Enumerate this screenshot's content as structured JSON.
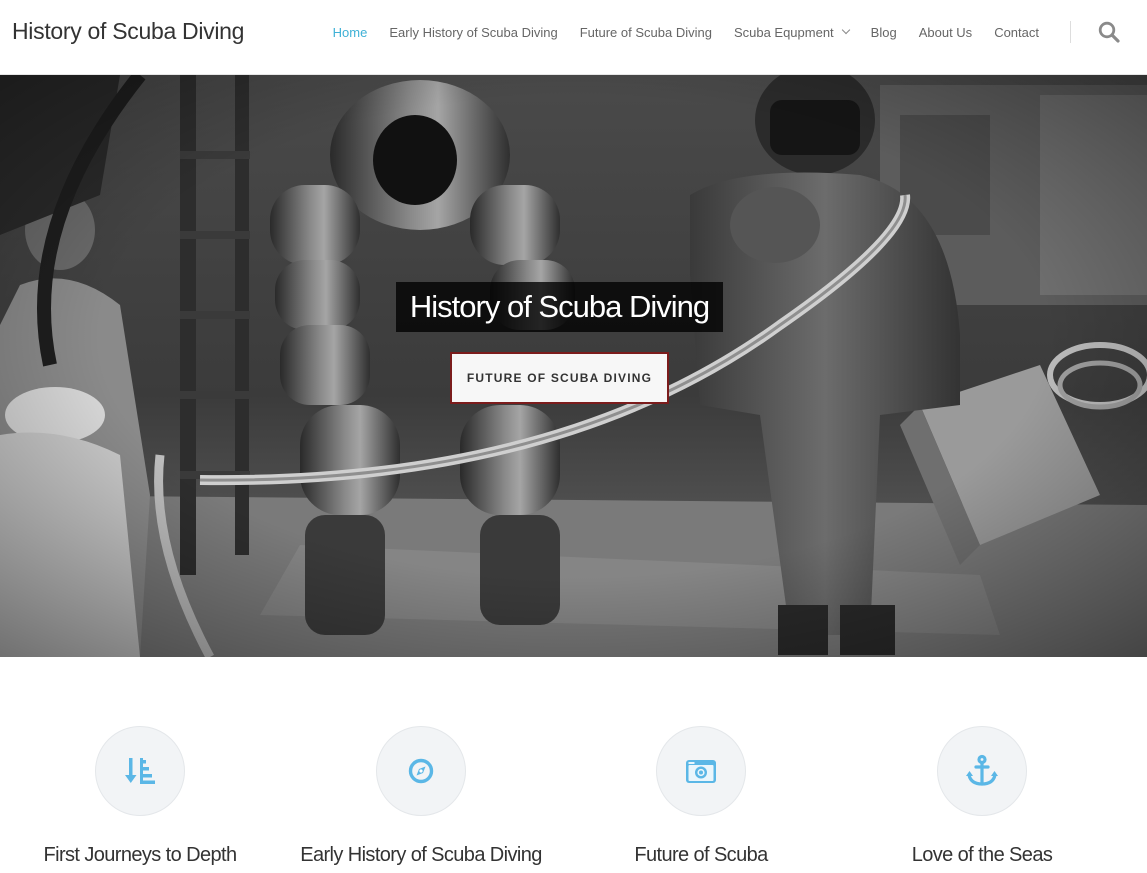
{
  "site": {
    "title": "History of Scuba Diving"
  },
  "nav": {
    "items": [
      {
        "label": "Home",
        "active": true
      },
      {
        "label": "Early History of Scuba Diving",
        "active": false
      },
      {
        "label": "Future of Scuba Diving",
        "active": false
      },
      {
        "label": "Scuba Equpment",
        "active": false,
        "has_dropdown": true
      },
      {
        "label": "Blog",
        "active": false
      },
      {
        "label": "About Us",
        "active": false
      },
      {
        "label": "Contact",
        "active": false
      }
    ],
    "search_icon": "search-icon"
  },
  "hero": {
    "title": "History of Scuba Diving",
    "button_label": "FUTURE OF SCUBA DIVING"
  },
  "features": [
    {
      "icon": "sort-down-icon",
      "title": "First Journeys to Depth"
    },
    {
      "icon": "compass-icon",
      "title": "Early History of Scuba Diving"
    },
    {
      "icon": "camera-icon",
      "title": "Future of Scuba"
    },
    {
      "icon": "anchor-icon",
      "title": "Love of the Seas"
    }
  ],
  "colors": {
    "accent": "#3fb1d6",
    "icon_blue": "#5bb7e6",
    "button_border": "#7b1c1c",
    "text": "#333333",
    "nav_text": "#666666"
  }
}
